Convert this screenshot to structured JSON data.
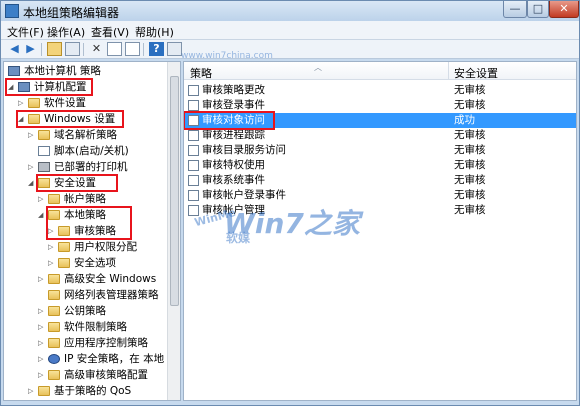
{
  "window": {
    "title": "本地组策略编辑器",
    "min_label": "—",
    "max_label": "□",
    "close_label": "✕"
  },
  "menu": [
    "文件(F)",
    "操作(A)",
    "查看(V)",
    "帮助(H)"
  ],
  "tree": [
    {
      "label": "本地计算机 策略",
      "icon": "computer-policy-icon"
    },
    {
      "label": "计算机配置",
      "icon": "computer-icon"
    },
    {
      "label": "软件设置",
      "icon": "folder-icon"
    },
    {
      "label": "Windows 设置",
      "icon": "folder-icon"
    },
    {
      "label": "域名解析策略",
      "icon": "folder-icon"
    },
    {
      "label": "脚本(启动/关机)",
      "icon": "script-icon"
    },
    {
      "label": "已部署的打印机",
      "icon": "printer-icon"
    },
    {
      "label": "安全设置",
      "icon": "security-icon"
    },
    {
      "label": "帐户策略",
      "icon": "folder-icon"
    },
    {
      "label": "本地策略",
      "icon": "folder-icon"
    },
    {
      "label": "审核策略",
      "icon": "folder-icon"
    },
    {
      "label": "用户权限分配",
      "icon": "folder-icon"
    },
    {
      "label": "安全选项",
      "icon": "folder-icon"
    },
    {
      "label": "高级安全 Windows",
      "icon": "folder-icon"
    },
    {
      "label": "网络列表管理器策略",
      "icon": "folder-icon"
    },
    {
      "label": "公钥策略",
      "icon": "folder-icon"
    },
    {
      "label": "软件限制策略",
      "icon": "folder-icon"
    },
    {
      "label": "应用程序控制策略",
      "icon": "folder-icon"
    },
    {
      "label": "IP 安全策略，在 本地",
      "icon": "shield-icon"
    },
    {
      "label": "高级审核策略配置",
      "icon": "folder-icon"
    },
    {
      "label": "基于策略的 QoS",
      "icon": "folder-icon"
    }
  ],
  "table": {
    "col_policy": "策略",
    "col_setting": "安全设置",
    "rows": [
      {
        "policy": "审核策略更改",
        "setting": "无审核"
      },
      {
        "policy": "审核登录事件",
        "setting": "无审核"
      },
      {
        "policy": "审核对象访问",
        "setting": "成功"
      },
      {
        "policy": "审核进程跟踪",
        "setting": "无审核"
      },
      {
        "policy": "审核目录服务访问",
        "setting": "无审核"
      },
      {
        "policy": "审核特权使用",
        "setting": "无审核"
      },
      {
        "policy": "审核系统事件",
        "setting": "无审核"
      },
      {
        "policy": "审核帐户登录事件",
        "setting": "无审核"
      },
      {
        "policy": "审核帐户管理",
        "setting": "无审核"
      }
    ]
  },
  "watermark": {
    "logo": "WinMe",
    "soft": "软媒",
    "brand": "Win7之家",
    "url": "www.win7china.com"
  }
}
